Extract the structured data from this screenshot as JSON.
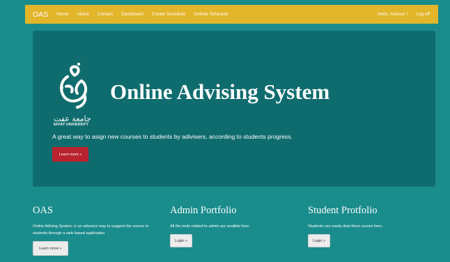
{
  "navbar": {
    "brand": "OAS",
    "links": [
      "Home",
      "About",
      "Contact",
      "Dashboard",
      "Create Schedule",
      "Onlinte Schedule"
    ],
    "greeting": "Hello, Advisor !",
    "logoff": "Log off"
  },
  "hero": {
    "logo_arabic": "جامعة عفت",
    "logo_english": "EFFAT UNIVERSITY",
    "title": "Online Advising System",
    "tagline": "A great way to asign new courses to students by adivisers, according to students progress.",
    "button": "Learn more »"
  },
  "columns": [
    {
      "title": "OAS",
      "text": "Online Adiving System, is an advance way to suggest the course to students through a web based application",
      "button": "Learn more »"
    },
    {
      "title": "Admin Portfolio",
      "text": "All the tools related to admin are avalible here.",
      "button": "Login »"
    },
    {
      "title": "Student Protfolio",
      "text": "Students can easily deal there coures here .",
      "button": "Login »"
    }
  ],
  "colors": {
    "page_background": "#1a8c8c",
    "navbar": "#e2b52a",
    "hero_background": "#0f6c6e",
    "primary_button": "#b8232f"
  }
}
